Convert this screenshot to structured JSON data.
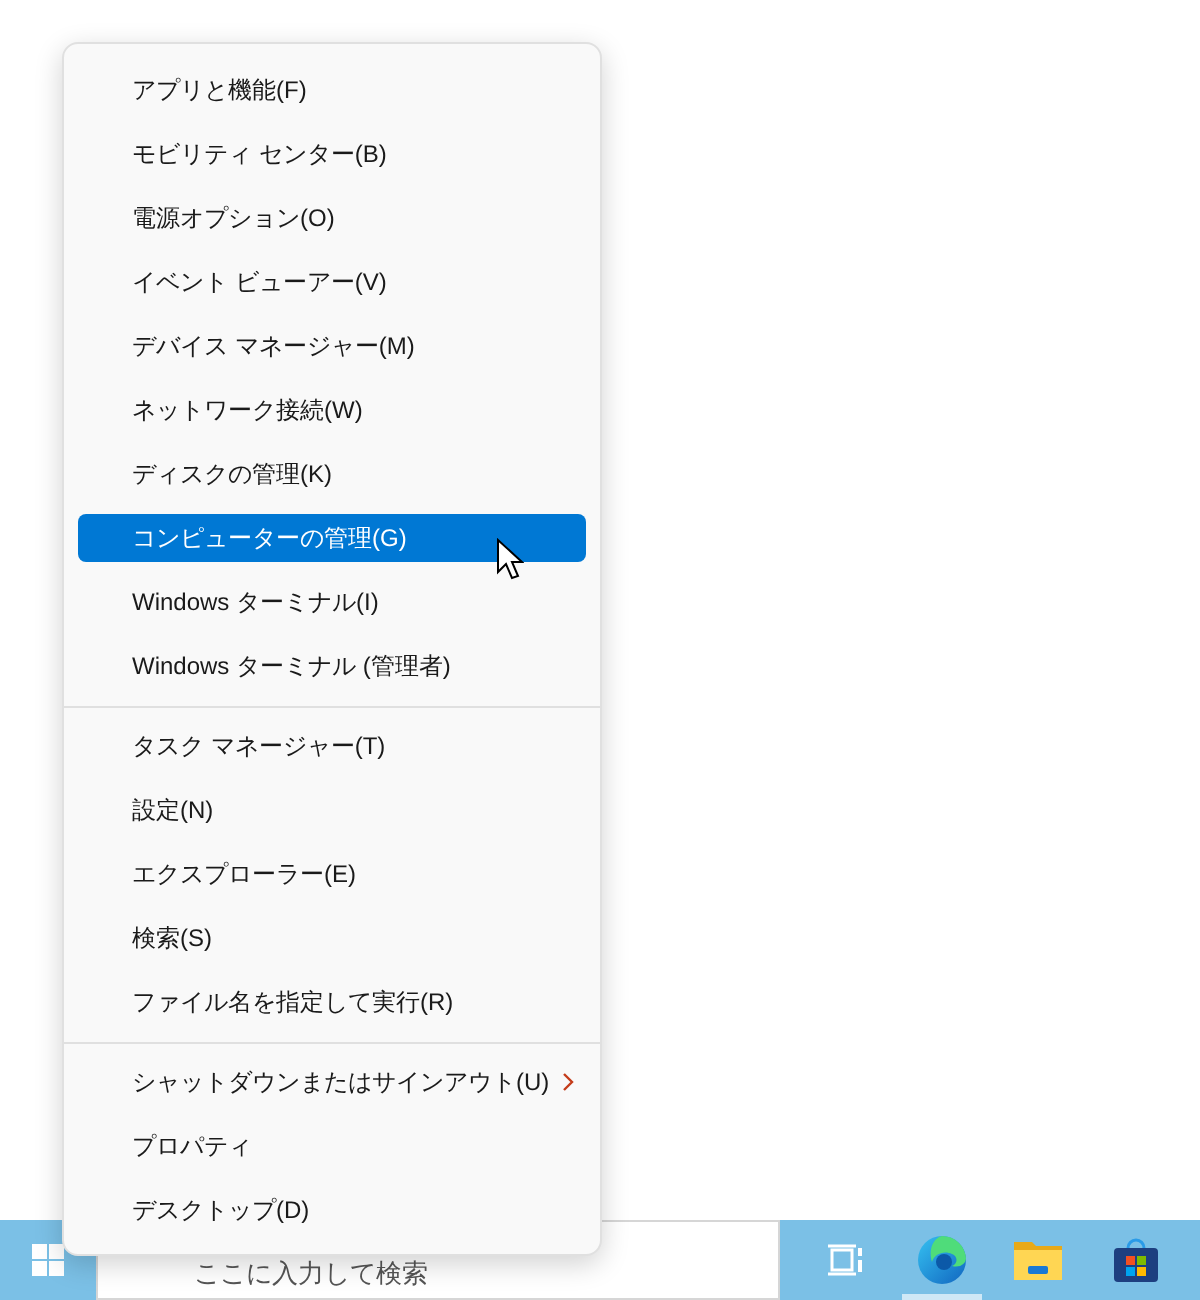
{
  "context_menu": {
    "sections": [
      {
        "items": [
          {
            "label": "アプリと機能(F)",
            "selected": false,
            "submenu": false
          },
          {
            "label": "モビリティ センター(B)",
            "selected": false,
            "submenu": false
          },
          {
            "label": "電源オプション(O)",
            "selected": false,
            "submenu": false
          },
          {
            "label": "イベント ビューアー(V)",
            "selected": false,
            "submenu": false
          },
          {
            "label": "デバイス マネージャー(M)",
            "selected": false,
            "submenu": false
          },
          {
            "label": "ネットワーク接続(W)",
            "selected": false,
            "submenu": false
          },
          {
            "label": "ディスクの管理(K)",
            "selected": false,
            "submenu": false
          },
          {
            "label": "コンピューターの管理(G)",
            "selected": true,
            "submenu": false
          },
          {
            "label": "Windows ターミナル(I)",
            "selected": false,
            "submenu": false
          },
          {
            "label": "Windows ターミナル (管理者)",
            "selected": false,
            "submenu": false
          }
        ]
      },
      {
        "items": [
          {
            "label": "タスク マネージャー(T)",
            "selected": false,
            "submenu": false
          },
          {
            "label": "設定(N)",
            "selected": false,
            "submenu": false
          },
          {
            "label": "エクスプローラー(E)",
            "selected": false,
            "submenu": false
          },
          {
            "label": "検索(S)",
            "selected": false,
            "submenu": false
          },
          {
            "label": "ファイル名を指定して実行(R)",
            "selected": false,
            "submenu": false
          }
        ]
      },
      {
        "items": [
          {
            "label": "シャットダウンまたはサインアウト(U)",
            "selected": false,
            "submenu": true
          },
          {
            "label": "プロパティ",
            "selected": false,
            "submenu": false
          },
          {
            "label": "デスクトップ(D)",
            "selected": false,
            "submenu": false
          }
        ]
      }
    ]
  },
  "taskbar": {
    "search": {
      "placeholder": "ここに入力して検索"
    },
    "apps": [
      {
        "kind": "task-view",
        "running": false
      },
      {
        "kind": "browser",
        "running": true
      },
      {
        "kind": "folder",
        "running": false
      },
      {
        "kind": "store",
        "running": false
      }
    ]
  }
}
